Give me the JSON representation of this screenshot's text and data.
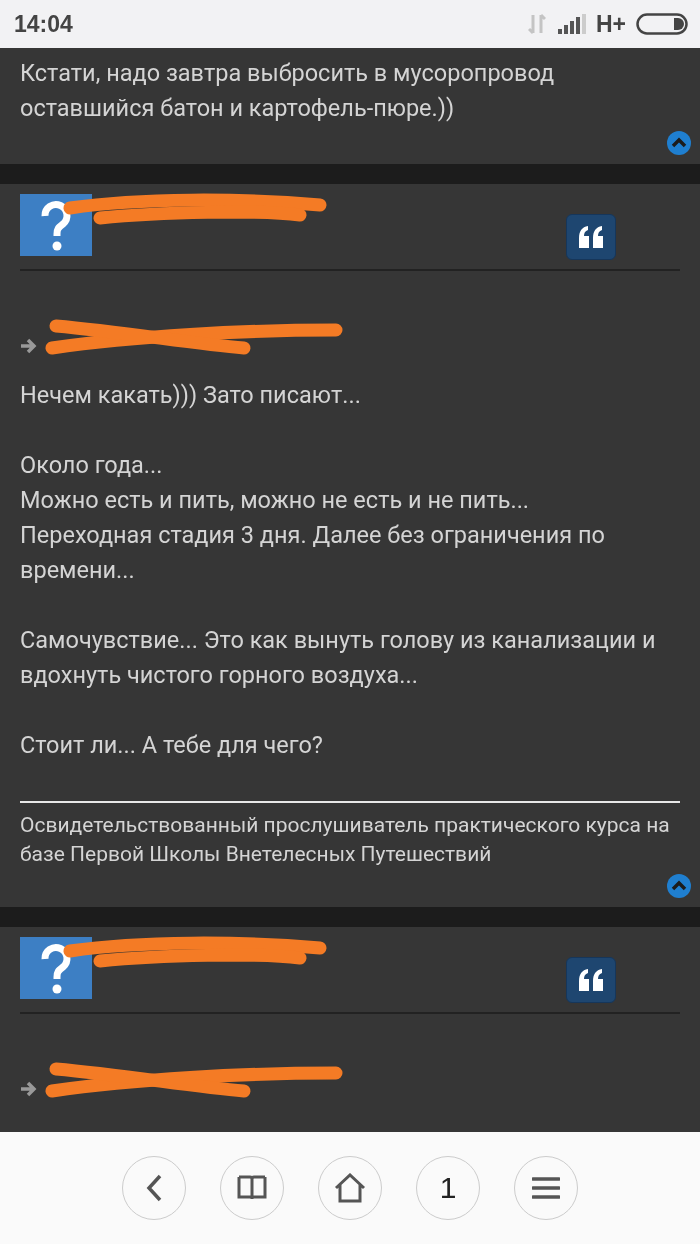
{
  "status_bar": {
    "time": "14:04",
    "network": "H+"
  },
  "posts": [
    {
      "kind": "continued",
      "body": [
        [
          "Кстати, надо завтра выбросить в мусоропровод оставшийся батон и картофель-пюре.))"
        ]
      ]
    },
    {
      "kind": "full",
      "body": [
        [
          "Нечем какать))) Зато писают..."
        ],
        [
          "Около года...",
          "Можно есть и пить, можно не есть и не пить...",
          "Переходная стадия 3 дня. Далее без ограничения по времени..."
        ],
        [
          "Самочувствие... Это как вынуть голову из канализации и вдохнуть чистого горного воздуха..."
        ],
        [
          "Стоит ли... А тебе для чего?"
        ]
      ],
      "signature": "Освидетельствованный прослушиватель практического курса на базе Первой Школы Внетелесных Путешествий"
    },
    {
      "kind": "full"
    }
  ],
  "nav": [
    {
      "kind": "back"
    },
    {
      "kind": "book"
    },
    {
      "kind": "home"
    },
    {
      "kind": "tabs",
      "label": "1"
    },
    {
      "kind": "menu"
    }
  ]
}
